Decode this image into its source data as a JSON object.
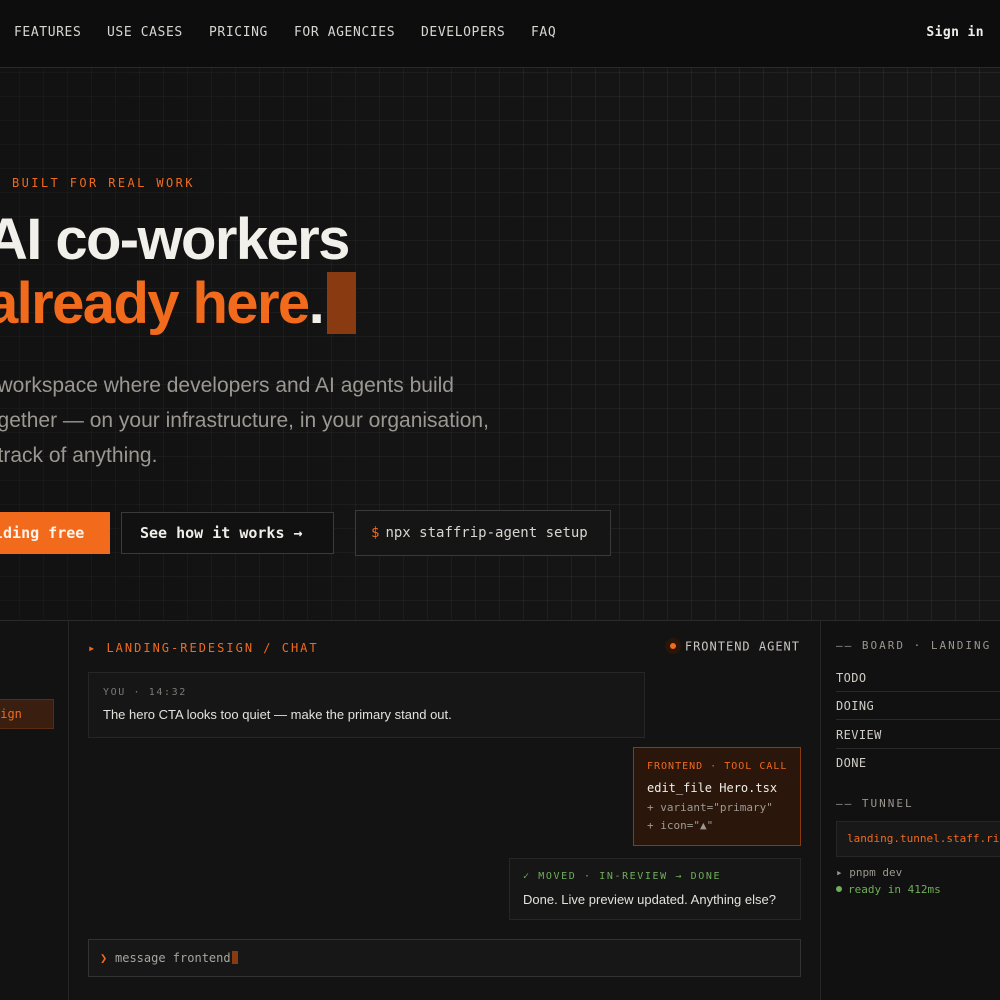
{
  "nav": {
    "items": [
      "FEATURES",
      "USE CASES",
      "PRICING",
      "FOR AGENCIES",
      "DEVELOPERS",
      "FAQ"
    ],
    "sign_in": "Sign in"
  },
  "hero": {
    "eyebrow": "BUILT FOR REAL WORK",
    "headline_line1": "AI co-workers",
    "headline_line2": "already here",
    "headline_dot": ".",
    "subtext": [
      "e workspace where developers and AI agents build",
      "together — on your infrastructure, in your organisation,",
      "g track of anything."
    ],
    "primary_cta": "lding free",
    "secondary_cta": "See how it works →",
    "command_prompt": "$",
    "command": "npx staffrip-agent setup"
  },
  "app": {
    "channel": "sign",
    "chat_header": "▸ LANDING-REDESIGN / CHAT",
    "agent_label": "FRONTEND AGENT",
    "user_message": {
      "meta": "YOU · 14:32",
      "text": "The hero CTA looks too quiet — make the primary stand out."
    },
    "tool_call": {
      "header": "FRONTEND · TOOL CALL",
      "file": "edit_file Hero.tsx",
      "diff": [
        "+ variant=\"primary\"",
        "+ icon=\"▲\""
      ]
    },
    "agent_message": {
      "status": "✓ MOVED · IN-REVIEW → DONE",
      "text": "Done. Live preview updated. Anything else?"
    },
    "composer": {
      "caret": "❯",
      "placeholder": "message frontend"
    },
    "board": {
      "header": "—— BOARD · LANDING",
      "columns": [
        "TODO",
        "DOING",
        "REVIEW",
        "DONE"
      ]
    },
    "tunnel": {
      "header": "—— TUNNEL",
      "url": "landing.tunnel.staff.ri",
      "log_command": "▸ pnpm dev",
      "log_status": "ready in 412ms"
    }
  },
  "colors": {
    "accent": "#f26b1d",
    "accent_dark": "#8a3a11",
    "success": "#6fae5a",
    "background": "#0e0e0e"
  }
}
